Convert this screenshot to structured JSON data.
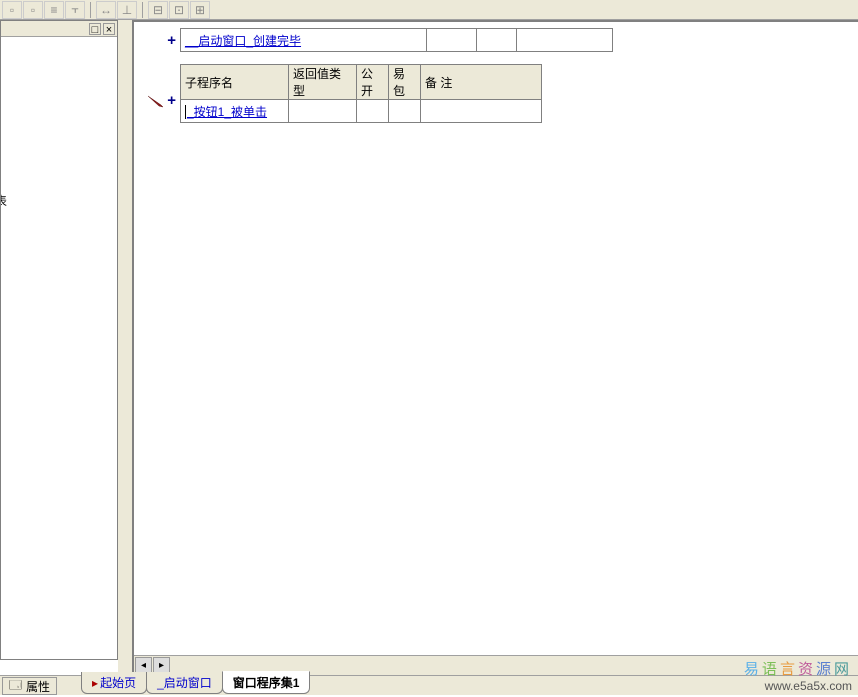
{
  "toolbar": {
    "buttons": [
      "b1",
      "b2",
      "b3",
      "b4",
      "b5",
      "b6",
      "b7",
      "b8",
      "b9",
      "b10"
    ]
  },
  "leftPanel": {
    "cutText": "表"
  },
  "code": {
    "callRow": {
      "name": "__启动窗口_创建完毕"
    },
    "subTable": {
      "headers": {
        "name": "子程序名",
        "ret": "返回值类型",
        "pub": "公开",
        "yb": "易包",
        "note": "备  注"
      },
      "row": {
        "name": "_按钮1_被单击",
        "ret": "",
        "pub": "",
        "yb": "",
        "note": ""
      }
    }
  },
  "bottom": {
    "propLabel": "属性",
    "tabs": {
      "start": "起始页",
      "window": "_启动窗口",
      "proc": "窗口程序集1"
    }
  },
  "watermark": {
    "chars": [
      "易",
      "语",
      "言",
      "资",
      "源",
      "网"
    ],
    "url": "www.e5a5x.com"
  }
}
